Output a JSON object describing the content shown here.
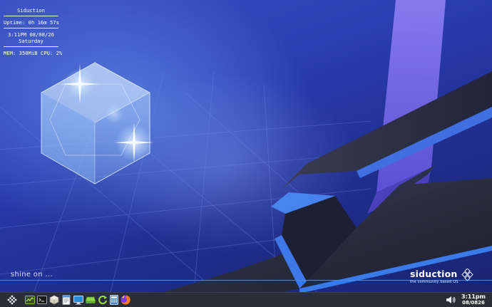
{
  "conky": {
    "hostname": "Siduction",
    "uptime": "Uptime: 0h 16m 57s",
    "time_date": "3:11PM  08/08/26",
    "weekday": "Saturday",
    "mem_cpu": "MEM: 350MiB  CPU: 2%"
  },
  "desktop": {
    "slogan": "shine on ...",
    "brand_name": "siduction",
    "brand_tagline": "the community based OS"
  },
  "taskbar": {
    "launchers": [
      {
        "name": "menu-icon"
      },
      {
        "name": "system-monitor-icon"
      },
      {
        "name": "terminal-icon"
      },
      {
        "name": "package-manager-icon"
      },
      {
        "name": "text-editor-icon"
      },
      {
        "name": "display-icon"
      },
      {
        "name": "disk-icon"
      },
      {
        "name": "refresh-icon"
      },
      {
        "name": "calculator-icon"
      },
      {
        "name": "firefox-icon"
      }
    ],
    "volume_icon": "volume-icon",
    "clock": {
      "time": "3:11pm",
      "date": "08/0826"
    }
  },
  "colors": {
    "accent_orange": "#d9652a",
    "taskbar_bg": "#2b2e36",
    "wallpaper_blue": "#2a3db0",
    "ribbon_purple": "#7a6ee8"
  }
}
